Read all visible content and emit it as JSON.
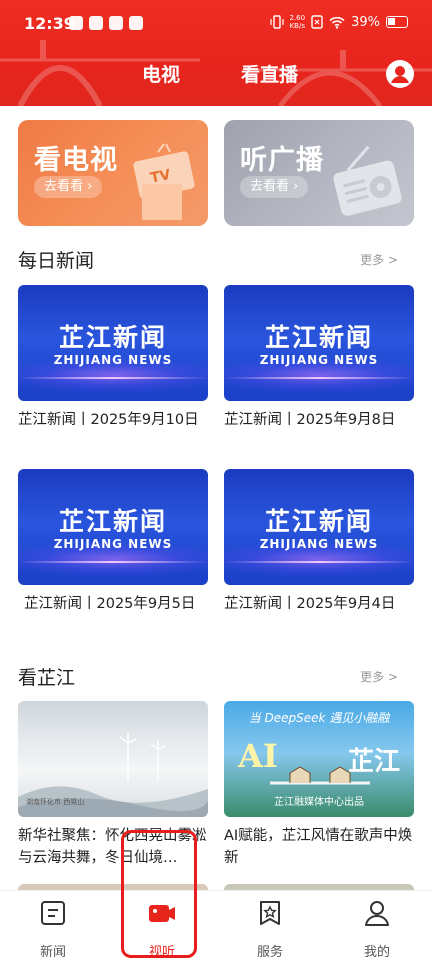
{
  "status_bar": {
    "time": "12:39",
    "net_speed_value": "2.60",
    "net_speed_unit": "KB/s",
    "battery": "39%"
  },
  "top_nav": {
    "tabs": [
      {
        "label": "电视",
        "active": true
      },
      {
        "label": "看直播",
        "active": false
      }
    ],
    "accent_color": "#e8251d"
  },
  "promos": [
    {
      "title": "看电视",
      "button": "去看看 ›",
      "art_label": "TV"
    },
    {
      "title": "听广播",
      "button": "去看看 ›"
    }
  ],
  "daily_news": {
    "title": "每日新闻",
    "more": "更多 >",
    "items": [
      {
        "thumb_cn": "芷江新闻",
        "thumb_en": "ZHIJIANG NEWS",
        "title": "芷江新闻丨2025年9月10日"
      },
      {
        "thumb_cn": "芷江新闻",
        "thumb_en": "ZHIJIANG NEWS",
        "title": "芷江新闻丨2025年9月8日"
      },
      {
        "thumb_cn": "芷江新闻",
        "thumb_en": "ZHIJIANG NEWS",
        "title": "芷江新闻丨2025年9月5日"
      },
      {
        "thumb_cn": "芷江新闻",
        "thumb_en": "ZHIJIANG NEWS",
        "title": "芷江新闻丨2025年9月4日"
      }
    ]
  },
  "zhijiang": {
    "title": "看芷江",
    "more": "更多 >",
    "items": [
      {
        "title": "新华社聚焦：怀化西晃山雾凇与云海共舞，冬日仙境…",
        "caption": "湖南怀化市 西晃山"
      },
      {
        "title": "AI赋能，芷江风情在歌声中焕新",
        "banner": "当 DeepSeek 遇见小融融",
        "big_left": "AI",
        "big_right": "芷江",
        "footer": "芷江融媒体中心出品"
      }
    ]
  },
  "bottom_nav": {
    "items": [
      {
        "label": "新闻",
        "icon": "news-icon",
        "active": false
      },
      {
        "label": "视听",
        "icon": "video-camera-icon",
        "active": true
      },
      {
        "label": "服务",
        "icon": "service-star-icon",
        "active": false
      },
      {
        "label": "我的",
        "icon": "profile-icon",
        "active": false
      }
    ]
  }
}
